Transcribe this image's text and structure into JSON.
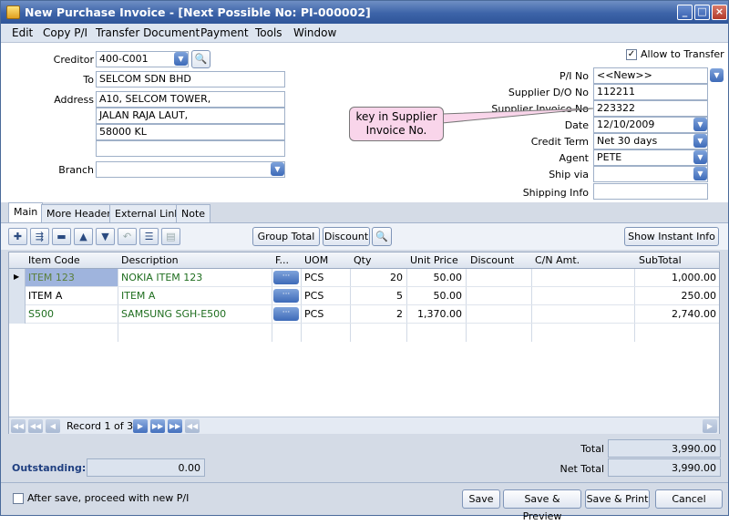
{
  "window": {
    "title": "New Purchase Invoice - [Next Possible No: PI-000002]"
  },
  "menu": [
    "Edit",
    "Copy P/I",
    "Transfer Document",
    "Payment",
    "Tools",
    "Window"
  ],
  "header": {
    "creditor_label": "Creditor",
    "creditor": "400-C001",
    "to_label": "To",
    "to": "SELCOM SDN BHD",
    "address_label": "Address",
    "address": [
      "A10, SELCOM TOWER,",
      "JALAN RAJA LAUT,",
      "58000 KL",
      ""
    ],
    "branch_label": "Branch",
    "branch": "",
    "allow_transfer": "Allow to Transfer",
    "pi_no_label": "P/I No",
    "pi_no": "<<New>>",
    "do_no_label": "Supplier D/O No",
    "do_no": "112211",
    "inv_no_label": "Supplier Invoice No",
    "inv_no": "223322",
    "date_label": "Date",
    "date": "12/10/2009",
    "credit_term_label": "Credit Term",
    "credit_term": "Net 30 days",
    "agent_label": "Agent",
    "agent": "PETE",
    "ship_via_label": "Ship via",
    "ship_via": "",
    "shipping_info_label": "Shipping Info",
    "shipping_info": ""
  },
  "callout": [
    "key in Supplier",
    "Invoice No."
  ],
  "tabs": [
    "Main",
    "More Header",
    "External Link",
    "Note"
  ],
  "toolbar": {
    "group_total": "Group Total",
    "discount": "Discount",
    "show_instant_info": "Show Instant Info"
  },
  "grid": {
    "columns": [
      "Item Code",
      "Description",
      "F...",
      "UOM",
      "Qty",
      "Unit Price",
      "Discount",
      "C/N Amt.",
      "SubTotal"
    ],
    "rows": [
      {
        "code": "ITEM 123",
        "desc": "NOKIA ITEM 123",
        "f": "···",
        "uom": "PCS",
        "qty": "20",
        "price": "50.00",
        "discount": "",
        "cn": "",
        "subtotal": "1,000.00"
      },
      {
        "code": "ITEM A",
        "desc": "ITEM A",
        "f": "···",
        "uom": "PCS",
        "qty": "5",
        "price": "50.00",
        "discount": "",
        "cn": "",
        "subtotal": "250.00"
      },
      {
        "code": "S500",
        "desc": "SAMSUNG SGH-E500",
        "f": "···",
        "uom": "PCS",
        "qty": "2",
        "price": "1,370.00",
        "discount": "",
        "cn": "",
        "subtotal": "2,740.00"
      }
    ],
    "record": "Record 1 of 3"
  },
  "totals": {
    "total_label": "Total",
    "total": "3,990.00",
    "net_total_label": "Net Total",
    "net_total": "3,990.00",
    "outstanding_label": "Outstanding:",
    "outstanding": "0.00"
  },
  "footer": {
    "proceed": "After save, proceed with new P/I",
    "save": "Save",
    "save_preview": "Save & Preview",
    "save_print": "Save & Print",
    "cancel": "Cancel"
  },
  "colors": {
    "titlebar": "#3c63a8",
    "accent": "#4470bd",
    "callout": "#f9d5ea",
    "grid_text": "#1f6e1f"
  }
}
